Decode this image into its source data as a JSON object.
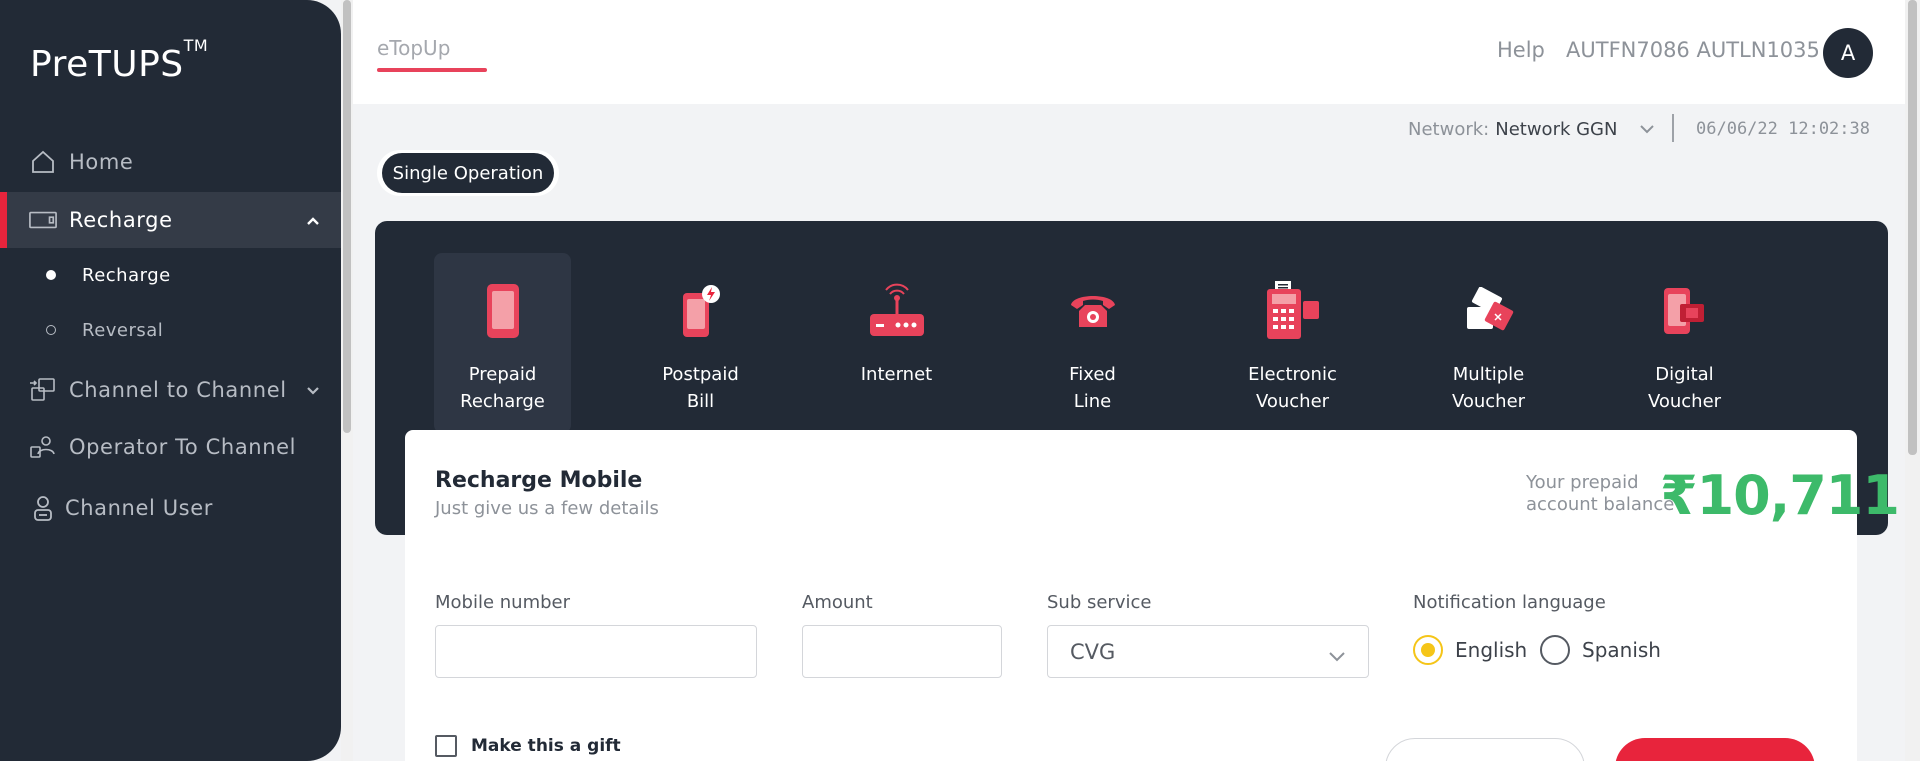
{
  "sidebar": {
    "logo": "PreTUPS",
    "logo_tm": "TM",
    "items": [
      {
        "label": "Home",
        "icon": "home-icon"
      },
      {
        "label": "Recharge",
        "icon": "recharge-icon",
        "active": true,
        "expanded": true
      },
      {
        "label": "Channel to Channel",
        "icon": "channel-transfer-icon",
        "collapsible": true
      },
      {
        "label": "Operator To Channel",
        "icon": "operator-channel-icon"
      },
      {
        "label": "Channel User",
        "icon": "user-icon"
      }
    ],
    "sub_items": [
      {
        "label": "Recharge",
        "active": true
      },
      {
        "label": "Reversal",
        "active": false
      }
    ]
  },
  "header": {
    "tab": "eTopUp",
    "help": "Help",
    "user_name": "AUTFN7086 AUTLN1035",
    "avatar_initial": "A"
  },
  "network_bar": {
    "label": "Network:",
    "value": "Network GGN",
    "datetime": "06/06/22 12:02:38"
  },
  "operation_pill": "Single Operation",
  "services": [
    {
      "line1": "Prepaid",
      "line2": "Recharge",
      "icon": "mobile-phone-icon",
      "active": true
    },
    {
      "line1": "Postpaid",
      "line2": "Bill",
      "icon": "postpaid-bill-icon"
    },
    {
      "line1": "Internet",
      "line2": "",
      "icon": "router-icon"
    },
    {
      "line1": "Fixed",
      "line2": "Line",
      "icon": "telephone-icon"
    },
    {
      "line1": "Electronic",
      "line2": "Voucher",
      "icon": "pos-terminal-icon"
    },
    {
      "line1": "Multiple",
      "line2": "Voucher",
      "icon": "multiple-voucher-icon"
    },
    {
      "line1": "Digital",
      "line2": "Voucher",
      "icon": "digital-voucher-icon"
    }
  ],
  "form": {
    "title": "Recharge Mobile",
    "subtitle": "Just give us a few details",
    "balance_label": "Your prepaid account balance",
    "balance_value": "₹10,711",
    "mobile_label": "Mobile number",
    "amount_label": "Amount",
    "subservice_label": "Sub service",
    "subservice_value": "CVG",
    "notif_label": "Notification language",
    "languages": [
      {
        "label": "English",
        "selected": true
      },
      {
        "label": "Spanish",
        "selected": false
      }
    ],
    "gift_label": "Make this a gift"
  },
  "colors": {
    "sidebar_bg": "#222a36",
    "accent_red": "#e8243c",
    "balance_green": "#3dba6a",
    "radio_yellow": "#f5c518"
  }
}
